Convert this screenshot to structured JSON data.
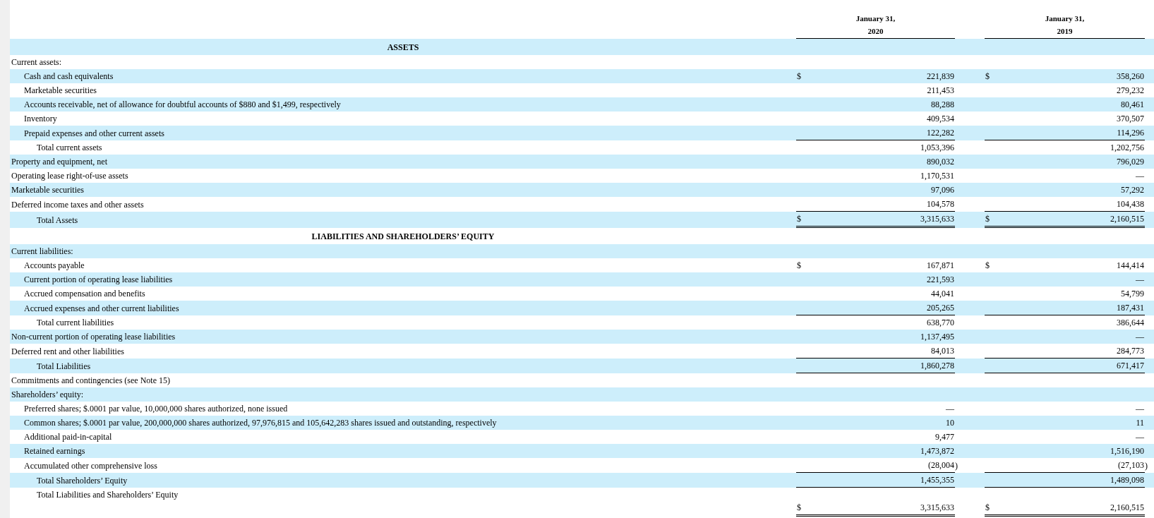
{
  "columns": [
    {
      "date": "January 31,",
      "year": "2020"
    },
    {
      "date": "January 31,",
      "year": "2019"
    }
  ],
  "rows": [
    {
      "kind": "section",
      "label": "ASSETS"
    },
    {
      "kind": "line",
      "label": "Current assets:",
      "children": [
        {
          "label": "Cash and cash equivalents",
          "values": [
            {
              "currency": "$",
              "amount": "221,839",
              "ruled": false,
              "double_ruled": false
            },
            {
              "currency": "$",
              "amount": "358,260",
              "ruled": false,
              "double_ruled": false
            }
          ]
        },
        {
          "label": "Marketable securities",
          "values": [
            {
              "amount": "211,453",
              "ruled": false,
              "double_ruled": false
            },
            {
              "amount": "279,232",
              "ruled": false,
              "double_ruled": false
            }
          ]
        },
        {
          "label": "Accounts receivable, net of allowance for doubtful accounts of $880 and $1,499, respectively",
          "values": [
            {
              "amount": "88,288",
              "ruled": false,
              "double_ruled": false
            },
            {
              "amount": "80,461",
              "ruled": false,
              "double_ruled": false
            }
          ]
        },
        {
          "label": "Inventory",
          "values": [
            {
              "amount": "409,534",
              "ruled": false,
              "double_ruled": false
            },
            {
              "amount": "370,507",
              "ruled": false,
              "double_ruled": false
            }
          ]
        },
        {
          "label": "Prepaid expenses and other current assets",
          "values": [
            {
              "amount": "122,282",
              "ruled": true,
              "double_ruled": false
            },
            {
              "amount": "114,296",
              "ruled": true,
              "double_ruled": false
            }
          ]
        }
      ]
    },
    {
      "kind": "total",
      "label": "Total current assets",
      "values": [
        {
          "amount": "1,053,396",
          "ruled": false,
          "double_ruled": false
        },
        {
          "amount": "1,202,756",
          "ruled": false,
          "double_ruled": false
        }
      ]
    },
    {
      "kind": "line",
      "label": "Property and equipment, net",
      "values": [
        {
          "amount": "890,032",
          "ruled": false,
          "double_ruled": false
        },
        {
          "amount": "796,029",
          "ruled": false,
          "double_ruled": false
        }
      ]
    },
    {
      "kind": "line",
      "label": "Operating lease right-of-use assets",
      "values": [
        {
          "amount": "1,170,531",
          "ruled": false,
          "double_ruled": false
        },
        {
          "amount": "—",
          "ruled": false,
          "double_ruled": false
        }
      ]
    },
    {
      "kind": "line",
      "label": "Marketable securities",
      "values": [
        {
          "amount": "97,096",
          "ruled": false,
          "double_ruled": false
        },
        {
          "amount": "57,292",
          "ruled": false,
          "double_ruled": false
        }
      ]
    },
    {
      "kind": "line",
      "label": "Deferred income taxes and other assets",
      "values": [
        {
          "amount": "104,578",
          "ruled": true,
          "double_ruled": false
        },
        {
          "amount": "104,438",
          "ruled": true,
          "double_ruled": false
        }
      ]
    },
    {
      "kind": "total",
      "label": "Total Assets",
      "values": [
        {
          "currency": "$",
          "amount": "3,315,633",
          "ruled": true,
          "double_ruled": true
        },
        {
          "currency": "$",
          "amount": "2,160,515",
          "ruled": true,
          "double_ruled": true
        }
      ]
    },
    {
      "kind": "section",
      "label": "LIABILITIES AND SHAREHOLDERS’ EQUITY"
    },
    {
      "kind": "line",
      "label": "Current liabilities:",
      "children": [
        {
          "label": "Accounts payable",
          "values": [
            {
              "currency": "$",
              "amount": "167,871",
              "ruled": false,
              "double_ruled": false
            },
            {
              "currency": "$",
              "amount": "144,414",
              "ruled": false,
              "double_ruled": false
            }
          ]
        },
        {
          "label": "Current portion of operating lease liabilities",
          "values": [
            {
              "amount": "221,593",
              "ruled": false,
              "double_ruled": false
            },
            {
              "amount": "—",
              "ruled": false,
              "double_ruled": false
            }
          ]
        },
        {
          "label": "Accrued compensation and benefits",
          "values": [
            {
              "amount": "44,041",
              "ruled": false,
              "double_ruled": false
            },
            {
              "amount": "54,799",
              "ruled": false,
              "double_ruled": false
            }
          ]
        },
        {
          "label": "Accrued expenses and other current liabilities",
          "values": [
            {
              "amount": "205,265",
              "ruled": true,
              "double_ruled": false
            },
            {
              "amount": "187,431",
              "ruled": true,
              "double_ruled": false
            }
          ]
        }
      ]
    },
    {
      "kind": "total",
      "label": "Total current liabilities",
      "values": [
        {
          "amount": "638,770",
          "ruled": false,
          "double_ruled": false
        },
        {
          "amount": "386,644",
          "ruled": false,
          "double_ruled": false
        }
      ]
    },
    {
      "kind": "line",
      "label": "Non-current portion of operating lease liabilities",
      "values": [
        {
          "amount": "1,137,495",
          "ruled": false,
          "double_ruled": false
        },
        {
          "amount": "—",
          "ruled": false,
          "double_ruled": false
        }
      ]
    },
    {
      "kind": "line",
      "label": "Deferred rent and other liabilities",
      "values": [
        {
          "amount": "84,013",
          "ruled": true,
          "double_ruled": false
        },
        {
          "amount": "284,773",
          "ruled": true,
          "double_ruled": false
        }
      ]
    },
    {
      "kind": "total",
      "label": "Total Liabilities",
      "values": [
        {
          "amount": "1,860,278",
          "ruled": true,
          "double_ruled": false
        },
        {
          "amount": "671,417",
          "ruled": true,
          "double_ruled": false
        }
      ]
    },
    {
      "kind": "line",
      "label": "Commitments and contingencies (see Note 15)"
    },
    {
      "kind": "line",
      "label": "Shareholders’ equity:",
      "children": [
        {
          "label": "Preferred shares; $.0001 par value, 10,000,000 shares authorized, none issued",
          "values": [
            {
              "amount": "—",
              "ruled": false,
              "double_ruled": false
            },
            {
              "amount": "—",
              "ruled": false,
              "double_ruled": false
            }
          ]
        },
        {
          "label": "Common shares; $.0001 par value, 200,000,000 shares authorized, 97,976,815 and 105,642,283 shares issued and outstanding, respectively",
          "values": [
            {
              "amount": "10",
              "ruled": false,
              "double_ruled": false
            },
            {
              "amount": "11",
              "ruled": false,
              "double_ruled": false
            }
          ]
        },
        {
          "label": "Additional paid-in-capital",
          "values": [
            {
              "amount": "9,477",
              "ruled": false,
              "double_ruled": false
            },
            {
              "amount": "—",
              "ruled": false,
              "double_ruled": false
            }
          ]
        },
        {
          "label": "Retained earnings",
          "values": [
            {
              "amount": "1,473,872",
              "ruled": false,
              "double_ruled": false
            },
            {
              "amount": "1,516,190",
              "ruled": false,
              "double_ruled": false
            }
          ]
        },
        {
          "label": "Accumulated other comprehensive loss",
          "values": [
            {
              "amount": "(28,004",
              "close": ")",
              "ruled": true,
              "double_ruled": false
            },
            {
              "amount": "(27,103",
              "close": ")",
              "ruled": true,
              "double_ruled": false
            }
          ]
        }
      ]
    },
    {
      "kind": "total",
      "label": "Total Shareholders’ Equity",
      "values": [
        {
          "amount": "1,455,355",
          "ruled": true,
          "double_ruled": false
        },
        {
          "amount": "1,489,098",
          "ruled": true,
          "double_ruled": false
        }
      ]
    },
    {
      "kind": "grand_total",
      "label": "Total Liabilities and Shareholders’ Equity",
      "values": [
        {
          "currency": "$",
          "amount": "3,315,633",
          "ruled": true,
          "double_ruled": true
        },
        {
          "currency": "$",
          "amount": "2,160,515",
          "ruled": true,
          "double_ruled": true
        }
      ]
    }
  ]
}
